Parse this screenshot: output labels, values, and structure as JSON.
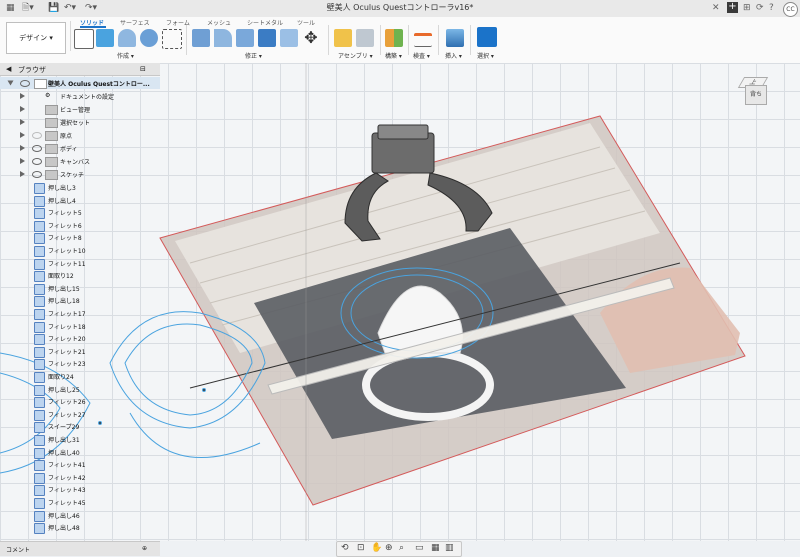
{
  "title_bar": {
    "doc_title": "壁美人 Oculus Questコントローラv16*",
    "icons": [
      "grid-icon",
      "file-icon",
      "save-icon",
      "undo-icon",
      "redo-icon",
      "close-tab-icon",
      "new-tab-icon",
      "extensions-icon",
      "job-status-icon",
      "notifications-icon",
      "help-icon"
    ],
    "user_initials": "CC"
  },
  "ribbon": {
    "workspace": "デザイン ▾",
    "tabs": [
      "ソリッド",
      "サーフェス",
      "フォーム",
      "メッシュ",
      "シートメタル",
      "ツール"
    ],
    "active_tab": "ソリッド",
    "groups": [
      "作成 ▾",
      "修正 ▾",
      "アセンブリ ▾",
      "構築 ▾",
      "検査 ▾",
      "挿入 ▾",
      "選択 ▾"
    ],
    "accent": "#1b73c9"
  },
  "browser": {
    "title": "ブラウザ",
    "root": "壁美人 Oculus Questコントロー...",
    "nodes": [
      {
        "label": "ドキュメントの設定"
      },
      {
        "label": "ビュー管理"
      },
      {
        "label": "選択セット"
      },
      {
        "label": "原点"
      },
      {
        "label": "ボディ"
      },
      {
        "label": "キャンバス"
      },
      {
        "label": "スケッチ"
      }
    ]
  },
  "timeline": {
    "features": [
      "押し出し3",
      "押し出し4",
      "フィレット5",
      "フィレット6",
      "フィレット8",
      "フィレット10",
      "フィレット11",
      "面取り12",
      "押し出し15",
      "押し出し18",
      "フィレット17",
      "フィレット18",
      "フィレット20",
      "フィレット21",
      "フィレット23",
      "面取り24",
      "押し出し25",
      "フィレット26",
      "フィレット27",
      "スイープ29",
      "押し出し31",
      "押し出し40",
      "フィレット41",
      "フィレット42",
      "フィレット43",
      "フィレット45",
      "押し出し46",
      "押し出し48"
    ]
  },
  "view_cube": {
    "top": "上",
    "front": "背ち"
  },
  "comments": {
    "label": "コメント"
  },
  "nav_bar": {
    "icons": [
      "orbit-icon",
      "pan-icon",
      "zoom-icon",
      "fit-icon",
      "display-mode-icon",
      "grid-settings-icon",
      "viewports-icon"
    ]
  }
}
